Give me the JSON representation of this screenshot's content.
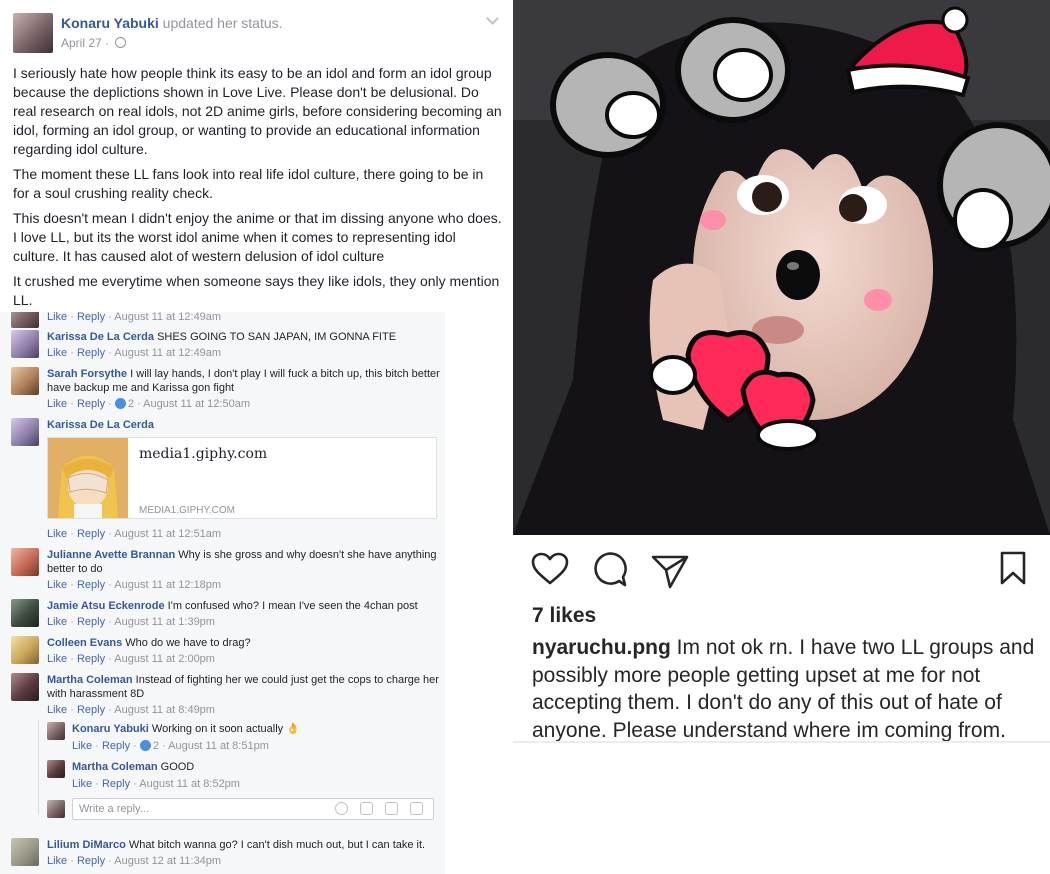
{
  "post": {
    "author": "Konaru Yabuki",
    "action": "updated her status.",
    "date": "April 27 · ",
    "paragraphs": [
      "I seriously hate how people think its easy to be an idol and form an idol group because the deplictions shown in Love Live. Please don't be delusional. Do real research on real idols, not 2D anime girls, before considering becoming an idol, forming an idol group, or wanting to provide an educational information regarding idol culture.",
      "The moment these LL fans look into real life idol culture, there going to be in for a soul crushing reality check.",
      "This doesn't mean I didn't enjoy the anime or that im dissing anyone who does. I love LL, but its the worst idol anime when it comes to representing idol culture. It has caused alot of western delusion of idol culture",
      "It crushed me everytime when someone says they like idols, they only mention LL."
    ]
  },
  "comments": {
    "like": "Like",
    "reply": "Reply",
    "sep": " · ",
    "items": [
      {
        "name": "",
        "text": "",
        "reactions": "",
        "time": "August 11 at 12:49am"
      },
      {
        "name": "Karissa De La Cerda",
        "text": "SHES GOING TO SAN JAPAN, IM GONNA FITE",
        "reactions": "",
        "time": "August 11 at 12:49am"
      },
      {
        "name": "Sarah Forsythe",
        "text": "I will lay hands, I don't play I will fuck a bitch up, this bitch better have backup me and Karissa gon fight",
        "reactions": "2",
        "time": "August 11 at 12:50am"
      },
      {
        "name": "Karissa De La Cerda",
        "text": "",
        "reactions": "",
        "time": "August 11 at 12:51am"
      },
      {
        "name": "Julianne Avette Brannan",
        "text": "Why is she gross and why doesn't she have anything better to do",
        "reactions": "",
        "time": "August 11 at 12:18pm"
      },
      {
        "name": "Jamie Atsu Eckenrode",
        "text": "I'm confused who? I mean I've seen the 4chan post",
        "reactions": "",
        "time": "August 11 at 1:39pm"
      },
      {
        "name": "Colleen Evans",
        "text": "Who do we have to drag?",
        "reactions": "",
        "time": "August 11 at 2:00pm"
      },
      {
        "name": "Martha Coleman",
        "text": "Instead of fighting her we could just get the cops to charge her with harassment 8D",
        "reactions": "",
        "time": "August 11 at 8:49pm"
      },
      {
        "name": "Lilium DiMarco",
        "text": "What bitch wanna go? I can't dish much out, but I can take it.",
        "reactions": "",
        "time": "August 12 at 11:34pm"
      }
    ],
    "replies": [
      {
        "name": "Konaru Yabuki",
        "text": "Working on it soon actually 👌",
        "reactions": "2",
        "time": "August 11 at 8:51pm"
      },
      {
        "name": "Martha Coleman",
        "text": "GOOD",
        "reactions": "",
        "time": "August 11 at 8:52pm"
      }
    ],
    "link_preview": {
      "title": "media1.giphy.com",
      "domain": "MEDIA1.GIPHY.COM"
    },
    "reply_placeholder": "Write a reply...",
    "reply_icons": [
      "emoji-icon",
      "camera-icon",
      "gif-icon",
      "sticker-icon"
    ]
  },
  "instagram": {
    "likes": "7 likes",
    "username": "nyaruchu.png",
    "caption": " Im not ok rn. I have two LL groups and possibly more people getting upset at me for not accepting them. I don't do any of this out of hate of anyone. Please understand where im coming from.",
    "actions": [
      "heart-icon",
      "comment-icon",
      "share-icon",
      "bookmark-icon"
    ]
  }
}
